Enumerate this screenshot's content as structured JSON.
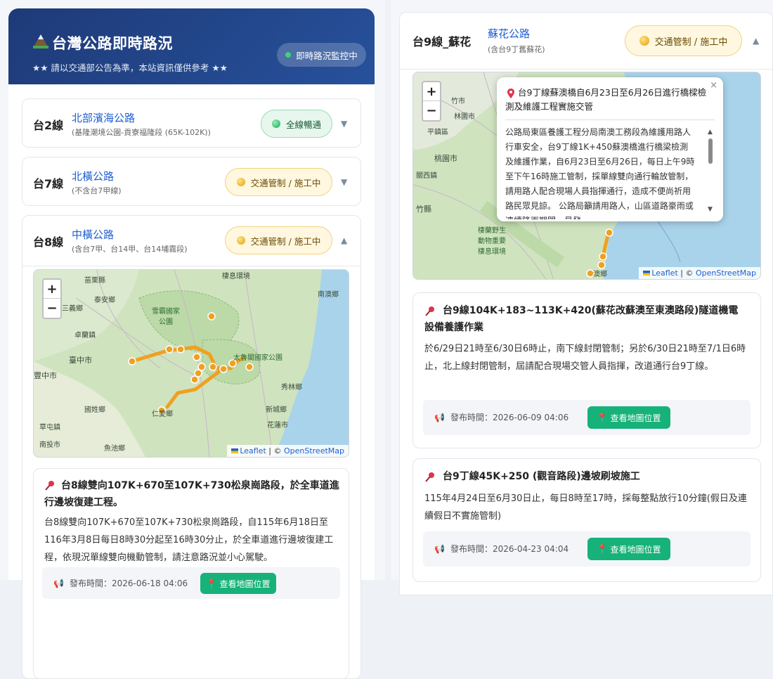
{
  "header": {
    "title": "台灣公路即時路況",
    "subtitle": "★★ 請以交通部公告為準，本站資訊僅供參考 ★★",
    "live_label": "即時路況監控中"
  },
  "routes": [
    {
      "code": "台2線",
      "name": "北部濱海公路",
      "note": "(基隆潮境公園-貢寮福隆段 (65K-102K))",
      "status": "全線暢通",
      "status_type": "ok",
      "chevron": "▼"
    },
    {
      "code": "台7線",
      "name": "北橫公路",
      "note": "(不含台7甲線)",
      "status": "交通管制 / 施工中",
      "status_type": "warn",
      "chevron": "▼"
    },
    {
      "code": "台8線",
      "name": "中橫公路",
      "note": "(含台7甲、台14甲、台14埔霧段)",
      "status": "交通管制 / 施工中",
      "status_type": "warn",
      "chevron": "▲"
    },
    {
      "code": "台9線_蘇花",
      "name": "蘇花公路",
      "note": "(含台9丁舊蘇花)",
      "status": "交通管制 / 施工中",
      "status_type": "warn",
      "chevron": "▲"
    }
  ],
  "map_common": {
    "zoom_in": "+",
    "zoom_out": "−",
    "leaflet": "Leaflet",
    "osm": "OpenStreetMap"
  },
  "map8_labels": [
    "苗栗縣",
    "泰安鄉",
    "三義鄉",
    "雪霸國家公園",
    "卓蘭鎮",
    "臺中市",
    "豐中市",
    "國姓鄉",
    "草屯鎮",
    "南投市",
    "魚池鄉",
    "仁愛鄉",
    "太魯閣國家公園",
    "秀林鄉",
    "新城鄉",
    "花蓮市",
    "南澳鄉",
    "棲息環境"
  ],
  "map9_labels": [
    "竹市",
    "林園市",
    "平鎮區",
    "桃園市",
    "關西鎮",
    "竹縣",
    "棲蘭野生動物重要棲息環境",
    "澳鄉"
  ],
  "popup": {
    "title": "台9丁線蘇澳橋自6月23日至6月26日進行橋樑檢測及維護工程實施交管",
    "body": "公路局東區養護工程分局南澳工務段為維護用路人行車安全，台9丁線1K+450蘇澳橋進行橋梁檢測及維護作業，自6月23日至6月26日，每日上午9時至下午16時施工管制，採單線雙向通行輪放管制，請用路人配合現場人員指揮通行，造成不便尚祈用路民眾見諒。 公路局籲請用路人，山區道路豪雨或連續降雨期間，易發",
    "close": "×"
  },
  "announcements": [
    {
      "title": "台8線雙向107K+670至107K+730松泉崗路段，於全車道進行邊坡復建工程。",
      "body": "台8線雙向107K+670至107K+730松泉崗路段，自115年6月18日至116年3月8日每日8時30分起至16時30分止，於全車道進行邊坡復建工程，依現況單線雙向機動管制，請注意路況並小心駕駛。",
      "time": "發布時間：2026-06-18 04:06",
      "button": "查看地圖位置"
    },
    {
      "title": "台9線104K+183~113K+420(蘇花改蘇澳至東澳路段)隧道機電設備養護作業",
      "body": "於6/29日21時至6/30日6時止，南下線封閉管制；另於6/30日21時至7/1日6時止，北上線封閉管制，屆請配合現場交管人員指揮，改道通行台9丁線。",
      "time": "發布時間：2026-06-09 04:06",
      "button": "查看地圖位置"
    },
    {
      "title": "台9丁線45K+250 (觀音路段)邊坡刷坡施工",
      "body": "115年4月24日至6月30日止，每日8時至17時，採每整點放行10分鐘(假日及連續假日不實施管制)",
      "time": "發布時間：2026-04-23 04:04",
      "button": "查看地圖位置"
    }
  ],
  "colors": {
    "header": "#1e3a78",
    "link": "#1f5fd0",
    "route_line": "#f0a020",
    "button": "#17b17a",
    "ok": "#20a558",
    "warn": "#e0a100"
  },
  "icons": {
    "pin": "pushpin-icon",
    "megaphone": "megaphone-icon",
    "location": "location-pin-icon"
  }
}
